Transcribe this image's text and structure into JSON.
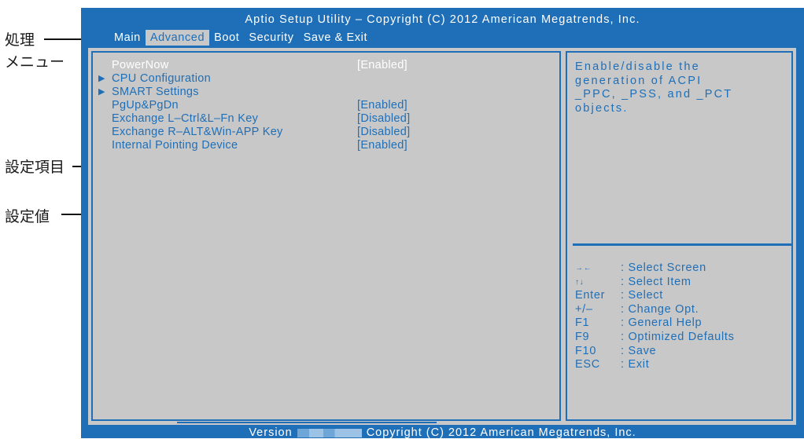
{
  "annotations": {
    "menu_label_line1": "処理",
    "menu_label_line2": "メニュー",
    "item_label": "設定項目",
    "value_label": "設定値"
  },
  "header": {
    "title": "Aptio Setup Utility – Copyright (C) 2012 American Megatrends, Inc."
  },
  "menu": [
    {
      "label": "Main",
      "active": false
    },
    {
      "label": "Advanced",
      "active": true
    },
    {
      "label": "Boot",
      "active": false
    },
    {
      "label": "Security",
      "active": false
    },
    {
      "label": "Save & Exit",
      "active": false
    }
  ],
  "settings": [
    {
      "name": "PowerNow",
      "value": "[Enabled]",
      "submenu": false,
      "highlighted": true
    },
    {
      "name": "CPU Configuration",
      "value": "",
      "submenu": true,
      "highlighted": false
    },
    {
      "name": "SMART Settings",
      "value": "",
      "submenu": true,
      "highlighted": false
    },
    {
      "name": "PgUp&PgDn",
      "value": "[Enabled]",
      "submenu": false,
      "highlighted": false
    },
    {
      "name": "Exchange L–Ctrl&L–Fn Key",
      "value": "[Disabled]",
      "submenu": false,
      "highlighted": false
    },
    {
      "name": "Exchange R–ALT&Win-APP Key",
      "value": "[Disabled]",
      "submenu": false,
      "highlighted": false
    },
    {
      "name": "Internal Pointing Device",
      "value": "[Enabled]",
      "submenu": false,
      "highlighted": false
    }
  ],
  "help": {
    "text": "Enable/disable the\ngeneration of ACPI\n_PPC, _PSS, and _PCT\nobjects."
  },
  "keys": [
    {
      "key": "→←",
      "desc": ": Select  Screen"
    },
    {
      "key": "↑↓",
      "desc": ": Select   Item"
    },
    {
      "key": "Enter",
      "desc": ": Select"
    },
    {
      "key": "+/–",
      "desc": ": Change Opt."
    },
    {
      "key": "F1",
      "desc": ": General  Help"
    },
    {
      "key": "F9",
      "desc": ": Optimized  Defaults"
    },
    {
      "key": "F10",
      "desc": ": Save"
    },
    {
      "key": "ESC",
      "desc": ": Exit"
    }
  ],
  "footer": {
    "version_label": "Version",
    "copyright": "Copyright  (C)  2012 American Megatrends,  Inc."
  },
  "colors": {
    "frame_blue": "#1f6fb8",
    "panel_gray": "#c8c8c8",
    "text_white": "#ffffff"
  }
}
